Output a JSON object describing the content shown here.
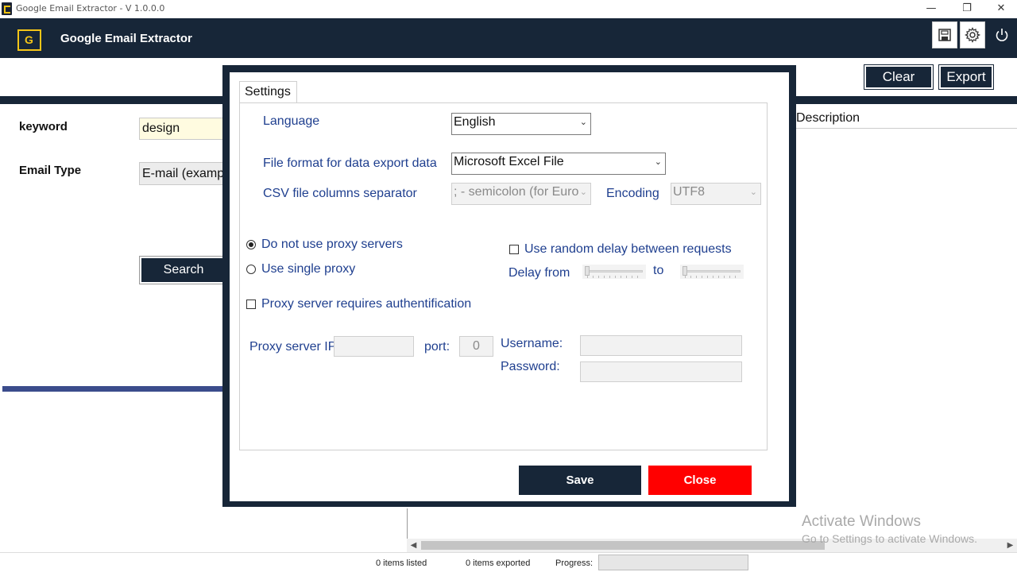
{
  "window": {
    "title": "Google Email Extractor - V 1.0.0.0",
    "minimize": "—",
    "restore": "❐",
    "close": "✕"
  },
  "header": {
    "logo_letter": "G",
    "app_name": "Google Email Extractor"
  },
  "toolbar": {
    "clear_label": "Clear",
    "export_label": "Export"
  },
  "form": {
    "keyword_label": "keyword",
    "keyword_value": "design",
    "email_type_label": "Email Type",
    "email_type_value": "E-mail (examp",
    "search_label": "Search"
  },
  "results": {
    "description_header": "Description"
  },
  "settings": {
    "tab_label": "Settings",
    "language_label": "Language",
    "language_value": "English",
    "file_format_label": "File format for data export data",
    "file_format_value": "Microsoft Excel File",
    "csv_separator_label": "CSV file columns separator",
    "csv_separator_value": "; - semicolon (for Euro",
    "encoding_label": "Encoding",
    "encoding_value": "UTF8",
    "no_proxy_label": "Do not use proxy servers",
    "single_proxy_label": "Use single proxy",
    "random_delay_label": "Use random delay between requests",
    "delay_from_label": "Delay from",
    "delay_to_label": "to",
    "proxy_auth_label": "Proxy server requires authentification",
    "proxy_ip_label": "Proxy server IP:",
    "port_label": "port:",
    "port_value": "0",
    "username_label": "Username:",
    "password_label": "Password:",
    "save_label": "Save",
    "close_label": "Close",
    "no_proxy_selected": true
  },
  "watermark": {
    "line1": "Activate Windows",
    "line2": "Go to Settings to activate Windows."
  },
  "status": {
    "listed": "0 items listed",
    "exported": "0 items exported",
    "progress_label": "Progress:",
    "progress_value": 0
  },
  "colors": {
    "navy": "#172638",
    "accent_yellow": "#f5c518",
    "close_red": "#ff0000",
    "label_blue": "#1f3f8f"
  }
}
